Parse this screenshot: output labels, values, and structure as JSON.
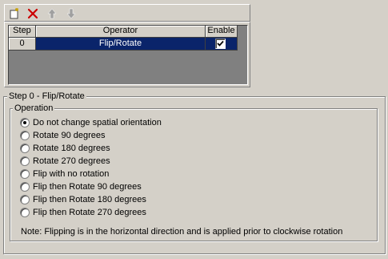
{
  "toolbar": {
    "buttons": [
      {
        "icon": "new-item-icon"
      },
      {
        "icon": "delete-icon",
        "color": "#cc0000"
      },
      {
        "icon": "arrow-up-icon"
      },
      {
        "icon": "arrow-down-icon"
      }
    ]
  },
  "grid": {
    "columns": [
      "Step",
      "Operator",
      "Enable"
    ],
    "rows": [
      {
        "step": "0",
        "operator": "Flip/Rotate",
        "enabled": true
      }
    ],
    "selection_color": "#0a246a"
  },
  "step_group": {
    "title": "Step 0 - Flip/Rotate",
    "operation": {
      "title": "Operation",
      "options": [
        "Do not change spatial orientation",
        "Rotate 90 degrees",
        "Rotate 180 degrees",
        "Rotate 270 degrees",
        "Flip with no rotation",
        "Flip then Rotate 90 degrees",
        "Flip then Rotate 180 degrees",
        "Flip then Rotate 270 degrees"
      ],
      "selected": "Do not change spatial orientation"
    },
    "note": "Note: Flipping is in the horizontal direction and is applied prior to clockwise rotation"
  }
}
